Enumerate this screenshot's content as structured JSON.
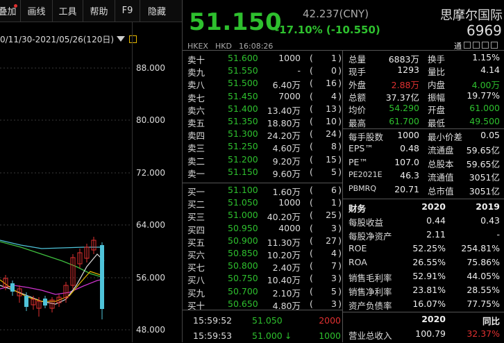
{
  "toolbar": {
    "items": [
      "叠加",
      "画线",
      "工具",
      "帮助",
      "F9",
      "隐藏"
    ]
  },
  "chart": {
    "range_label": "0/11/30-2021/05/26(120日)",
    "y_ticks": [
      "88.000",
      "80.000",
      "72.000",
      "64.000",
      "56.000",
      "48.000"
    ]
  },
  "quote": {
    "price": "51.150",
    "cny_price": "42.237(CNY)",
    "change": "-17.10% (-10.550)",
    "name": "思摩尔国际",
    "code": "6969",
    "exchange": "HKEX",
    "currency": "HKD",
    "time": "16:08:26",
    "tag1": "通",
    "colors": {
      "down": "#2ec02e",
      "up": "#e03030"
    }
  },
  "asks": [
    {
      "label": "卖十",
      "price": "51.600",
      "vol": "1000",
      "count": "1"
    },
    {
      "label": "卖九",
      "price": "51.550",
      "vol": "-",
      "count": "0"
    },
    {
      "label": "卖八",
      "price": "51.500",
      "vol": "6.40万",
      "count": "16"
    },
    {
      "label": "卖七",
      "price": "51.450",
      "vol": "7000",
      "count": "4"
    },
    {
      "label": "卖六",
      "price": "51.400",
      "vol": "13.40万",
      "count": "13"
    },
    {
      "label": "卖五",
      "price": "51.350",
      "vol": "18.80万",
      "count": "10"
    },
    {
      "label": "卖四",
      "price": "51.300",
      "vol": "24.20万",
      "count": "24"
    },
    {
      "label": "卖三",
      "price": "51.250",
      "vol": "4.60万",
      "count": "8"
    },
    {
      "label": "卖二",
      "price": "51.200",
      "vol": "9.20万",
      "count": "15"
    },
    {
      "label": "卖一",
      "price": "51.150",
      "vol": "9.60万",
      "count": "5"
    }
  ],
  "bids": [
    {
      "label": "买一",
      "price": "51.100",
      "vol": "1.60万",
      "count": "6"
    },
    {
      "label": "买二",
      "price": "51.050",
      "vol": "1000",
      "count": "1"
    },
    {
      "label": "买三",
      "price": "51.000",
      "vol": "40.20万",
      "count": "25"
    },
    {
      "label": "买四",
      "price": "50.950",
      "vol": "4000",
      "count": "3"
    },
    {
      "label": "买五",
      "price": "50.900",
      "vol": "11.30万",
      "count": "27"
    },
    {
      "label": "买六",
      "price": "50.850",
      "vol": "10.20万",
      "count": "4"
    },
    {
      "label": "买七",
      "price": "50.800",
      "vol": "2.40万",
      "count": "7"
    },
    {
      "label": "买八",
      "price": "50.750",
      "vol": "10.40万",
      "count": "3"
    },
    {
      "label": "买九",
      "price": "50.700",
      "vol": "2.10万",
      "count": "5"
    },
    {
      "label": "买十",
      "price": "50.650",
      "vol": "4.80万",
      "count": "3"
    }
  ],
  "trades": [
    {
      "time": "15:59:52",
      "price": "51.050",
      "vol": "2000",
      "arrow": ""
    },
    {
      "time": "15:59:53",
      "price": "51.000",
      "vol": "1000",
      "arrow": "↓"
    }
  ],
  "stats": [
    {
      "l1": "总量",
      "v1": "6883万",
      "c1": "white",
      "l2": "换手",
      "v2": "1.15%",
      "c2": "white"
    },
    {
      "l1": "现手",
      "v1": "1293",
      "c1": "white",
      "l2": "量比",
      "v2": "4.14",
      "c2": "white"
    },
    {
      "l1": "外盘",
      "v1": "2.88万",
      "c1": "red",
      "l2": "内盘",
      "v2": "4.00万",
      "c2": "green"
    },
    {
      "l1": "总额",
      "v1": "37.37亿",
      "c1": "white",
      "l2": "振幅",
      "v2": "19.77%",
      "c2": "white"
    },
    {
      "l1": "均价",
      "v1": "54.290",
      "c1": "green",
      "l2": "开盘",
      "v2": "61.000",
      "c2": "green"
    },
    {
      "l1": "最高",
      "v1": "61.700",
      "c1": "green",
      "l2": "最低",
      "v2": "49.500",
      "c2": "green"
    }
  ],
  "stats2": [
    {
      "l1": "每手股数",
      "v1": "1000",
      "l2": "最小价差",
      "v2": "0.05"
    },
    {
      "l1": "EPS™",
      "v1": "0.48",
      "l2": "流通盘",
      "v2": "59.65亿"
    },
    {
      "l1": "PE™",
      "v1": "107.0",
      "l2": "总股本",
      "v2": "59.65亿"
    },
    {
      "l1": "PE2021E",
      "v1": "46.3",
      "l2": "流通值",
      "v2": "3051亿"
    },
    {
      "l1": "PBMRQ",
      "v1": "20.71",
      "l2": "总市值",
      "v2": "3051亿"
    }
  ],
  "finance": {
    "header": [
      "财务",
      "2020",
      "2019"
    ],
    "rows": [
      {
        "label": "每股收益",
        "a": "0.44",
        "b": "0.43"
      },
      {
        "label": "每股净资产",
        "a": "2.11",
        "b": "-"
      },
      {
        "label": "ROE",
        "a": "52.25%",
        "b": "254.81%"
      },
      {
        "label": "ROA",
        "a": "26.55%",
        "b": "75.86%"
      },
      {
        "label": "销售毛利率",
        "a": "52.91%",
        "b": "44.05%"
      },
      {
        "label": "销售净利率",
        "a": "23.81%",
        "b": "28.55%"
      },
      {
        "label": "资产负债率",
        "a": "16.07%",
        "b": "77.75%"
      }
    ],
    "header2": [
      "2020",
      "同比"
    ],
    "rev": {
      "label": "营业总收入",
      "a": "100.79",
      "b": "32.37%"
    }
  }
}
